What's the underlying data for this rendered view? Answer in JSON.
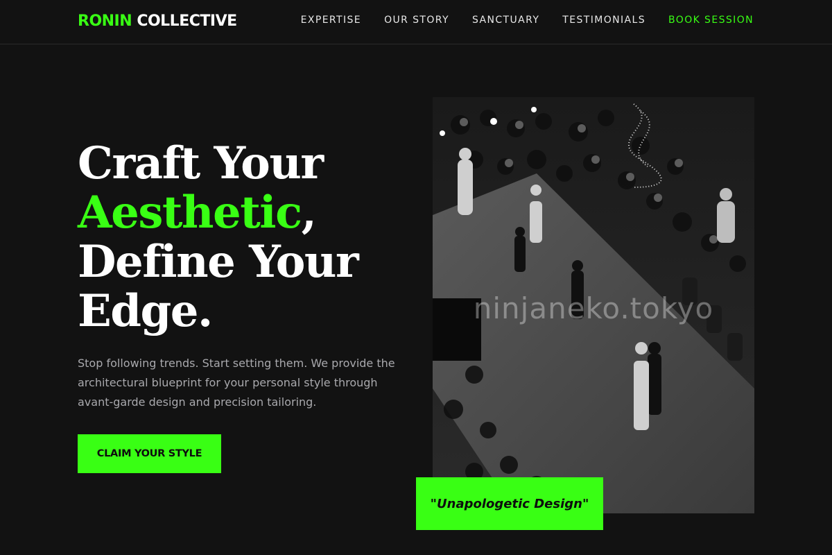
{
  "brand": {
    "accent": "RONIN",
    "rest": " COLLECTIVE",
    "accent_color": "#39ff14"
  },
  "nav": {
    "items": [
      {
        "label": "EXPERTISE"
      },
      {
        "label": "OUR STORY"
      },
      {
        "label": "SANCTUARY"
      },
      {
        "label": "TESTIMONIALS"
      }
    ],
    "cta": "BOOK SESSION"
  },
  "hero": {
    "line1": "Craft Your",
    "highlight": "Aesthetic",
    "comma": ",",
    "line3": "Define Your",
    "line4": "Edge.",
    "subtext": "Stop following trends. Start setting them. We provide the architectural blueprint for your personal style through avant-garde design and precision tailoring.",
    "button": "CLAIM YOUR STYLE"
  },
  "image": {
    "subject": "runway-fashion-show-photo",
    "watermark": "ninjaneko.tokyo"
  },
  "quote_badge": "\"Unapologetic Design\"",
  "colors": {
    "background": "#121212",
    "accent": "#39ff14",
    "body_text": "#a9a9ad"
  }
}
